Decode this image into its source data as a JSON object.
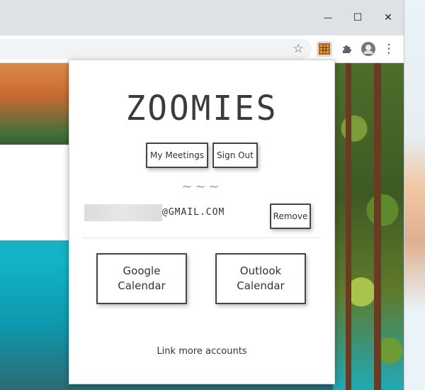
{
  "browser": {
    "window_controls": {
      "minimize": "—",
      "maximize": "☐",
      "close": "✕"
    },
    "toolbar_icons": {
      "star": "☆",
      "extensions": "🧩",
      "menu": "⋮"
    }
  },
  "popup": {
    "logo": "ZOOMIES",
    "my_meetings_label": "My Meetings",
    "sign_out_label": "Sign Out",
    "separator": "~~~",
    "email_domain": "@GMAIL.COM",
    "remove_label": "Remove",
    "google_calendar_label": "Google\nCalendar",
    "outlook_calendar_label": "Outlook\nCalendar",
    "link_more_label": "Link more accounts"
  }
}
